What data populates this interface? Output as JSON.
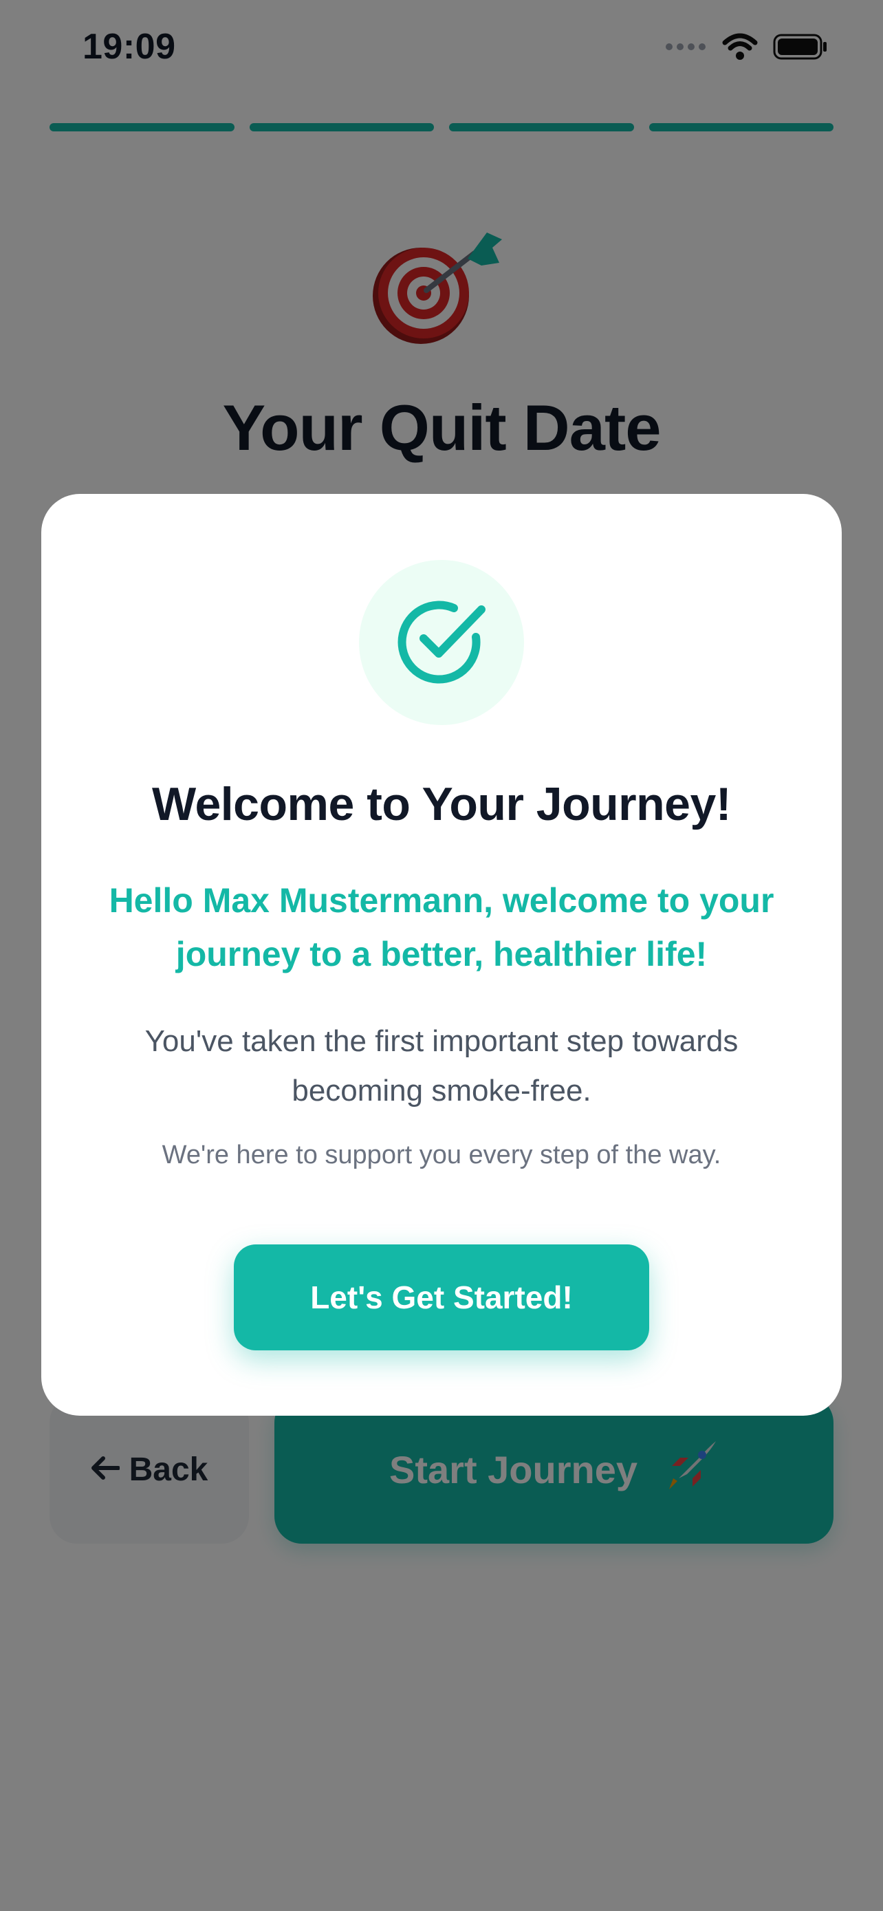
{
  "status_bar": {
    "time": "19:09"
  },
  "progress": {
    "total_steps": 4,
    "completed_steps": 4,
    "color": "#14b8a6"
  },
  "background_page": {
    "title": "Your Quit Date",
    "hero_icon": "target-dart-emoji",
    "back_button_label": "Back",
    "back_icon": "arrow-left-icon",
    "start_button_label": "Start Journey",
    "start_icon": "rocket-emoji"
  },
  "modal": {
    "icon": "check-circle-icon",
    "title": "Welcome to Your Journey!",
    "greeting": "Hello Max Mustermann, welcome to your journey to a better, healthier life!",
    "body": "You've taken the first important step towards becoming smoke-free.",
    "support_text": "We're here to support you every step of the way.",
    "cta_label": "Let's Get Started!"
  },
  "colors": {
    "accent": "#14b8a6",
    "title_text": "#111827",
    "body_text": "#4b5563",
    "overlay": "rgba(0,0,0,0.5)"
  }
}
